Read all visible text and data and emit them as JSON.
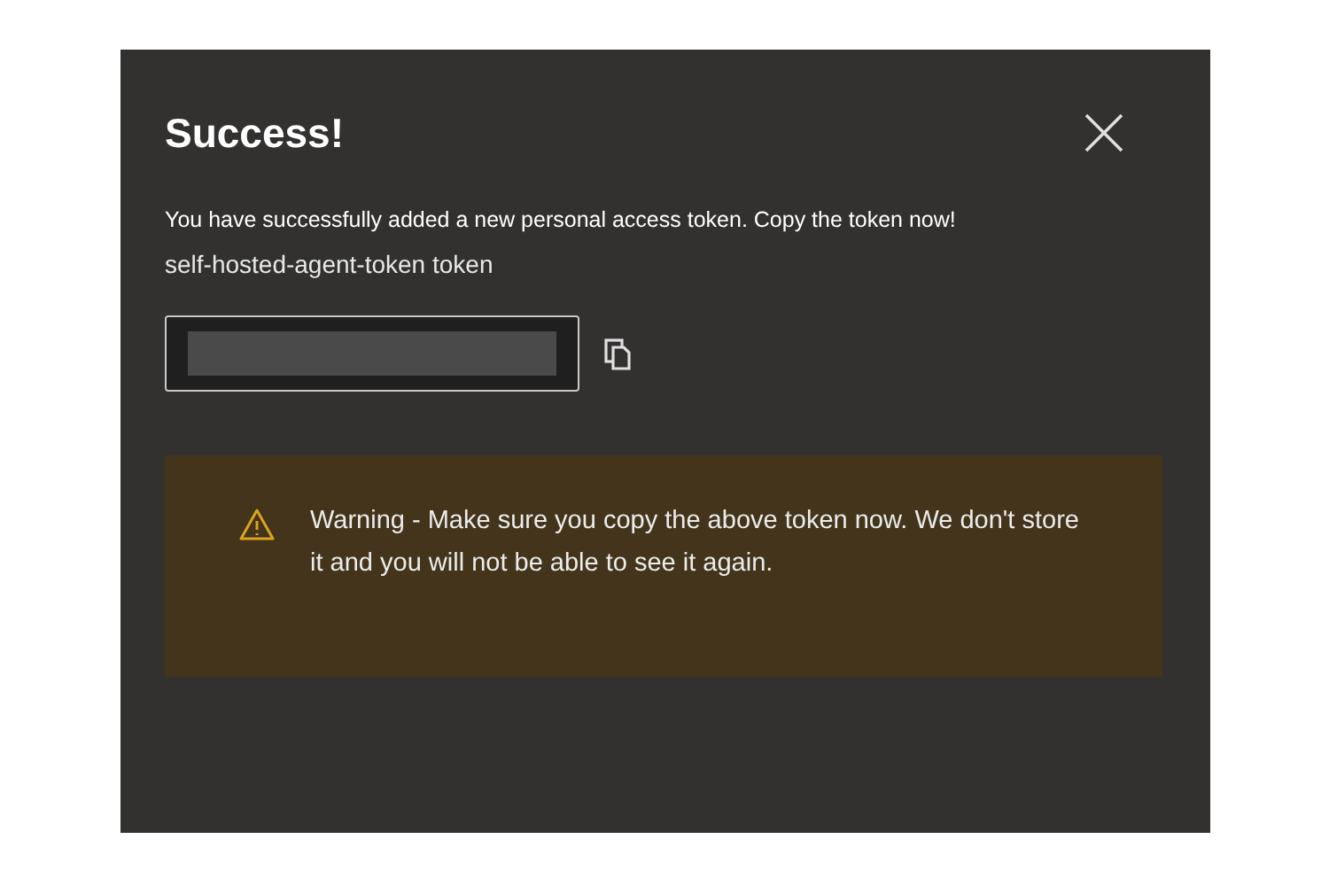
{
  "dialog": {
    "title": "Success!",
    "message": "You have successfully added a new personal access token. Copy the token now!",
    "token_name": "self-hosted-agent-token token"
  },
  "warning": {
    "text": "Warning - Make sure you copy the above token now. We don't store it and you will not be able to see it again."
  }
}
